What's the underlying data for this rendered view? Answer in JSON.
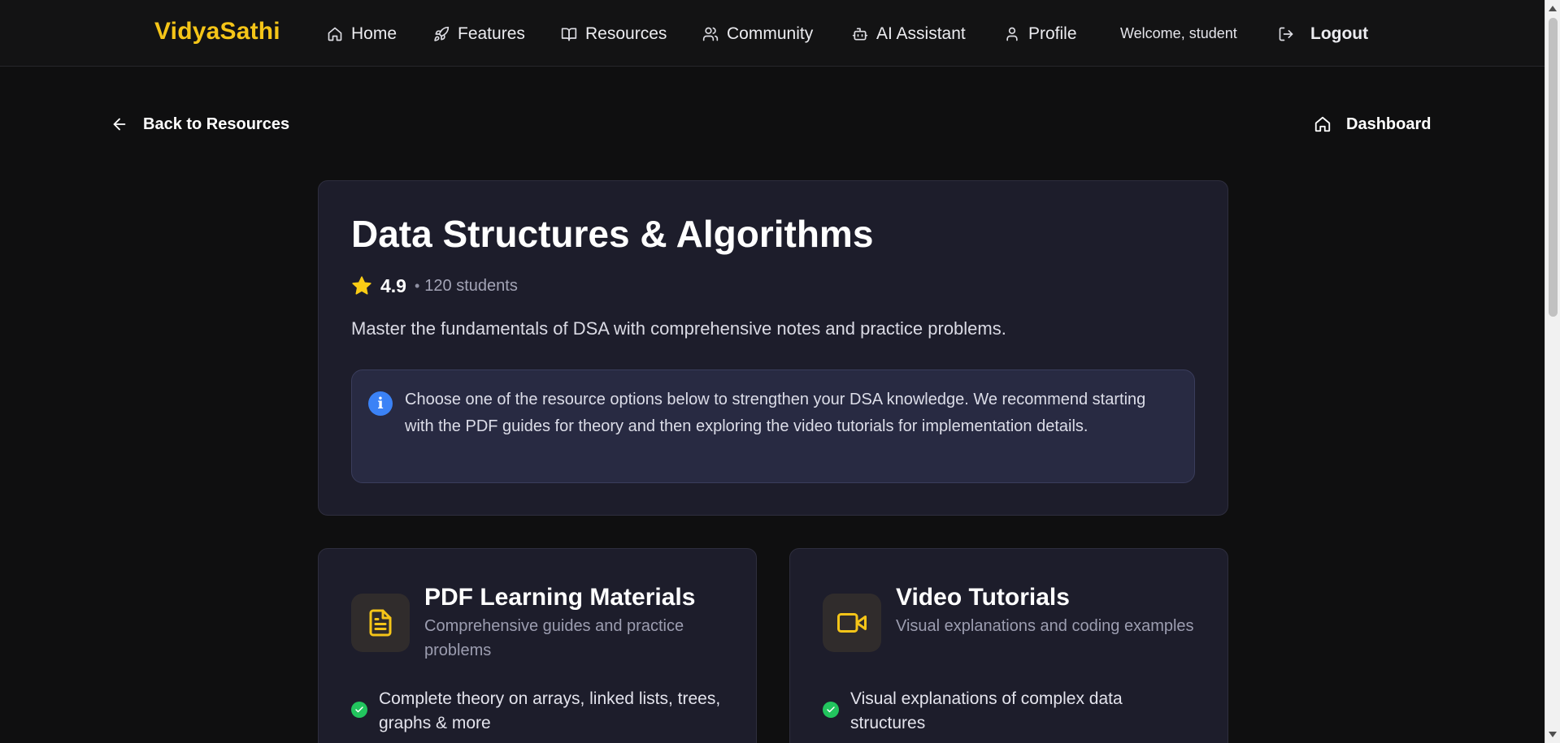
{
  "brand": "VidyaSathi",
  "nav": {
    "items": [
      {
        "label": "Home",
        "icon": "home-icon"
      },
      {
        "label": "Features",
        "icon": "rocket-icon"
      },
      {
        "label": "Resources",
        "icon": "book-open-icon"
      },
      {
        "label": "Community",
        "icon": "users-icon"
      },
      {
        "label": "AI Assistant",
        "icon": "bot-icon"
      },
      {
        "label": "Profile",
        "icon": "user-icon"
      }
    ],
    "welcome": "Welcome, student",
    "logout": "Logout"
  },
  "subnav": {
    "back": "Back to Resources",
    "dashboard": "Dashboard"
  },
  "course": {
    "title": "Data Structures & Algorithms",
    "rating": "4.9",
    "separator": "•",
    "students": "120 students",
    "description": "Master the fundamentals of DSA with comprehensive notes and practice problems.",
    "info_glyph": "i",
    "info": "Choose one of the resource options below to strengthen your DSA knowledge. We recommend starting with the PDF guides for theory and then exploring the video tutorials for implementation details."
  },
  "resources": [
    {
      "title": "PDF Learning Materials",
      "subtitle": "Comprehensive guides and practice problems",
      "icon": "file-text-icon",
      "features": [
        "Complete theory on arrays, linked lists, trees, graphs & more"
      ]
    },
    {
      "title": "Video Tutorials",
      "subtitle": "Visual explanations and coding examples",
      "icon": "video-icon",
      "features": [
        "Visual explanations of complex data structures"
      ]
    }
  ],
  "colors": {
    "brand": "#f5c518",
    "background": "#0f0f10",
    "card": "#1d1d2b",
    "info_box": "#282a42",
    "info_icon": "#3b82f6",
    "check": "#22c55e",
    "star": "#facc15"
  }
}
